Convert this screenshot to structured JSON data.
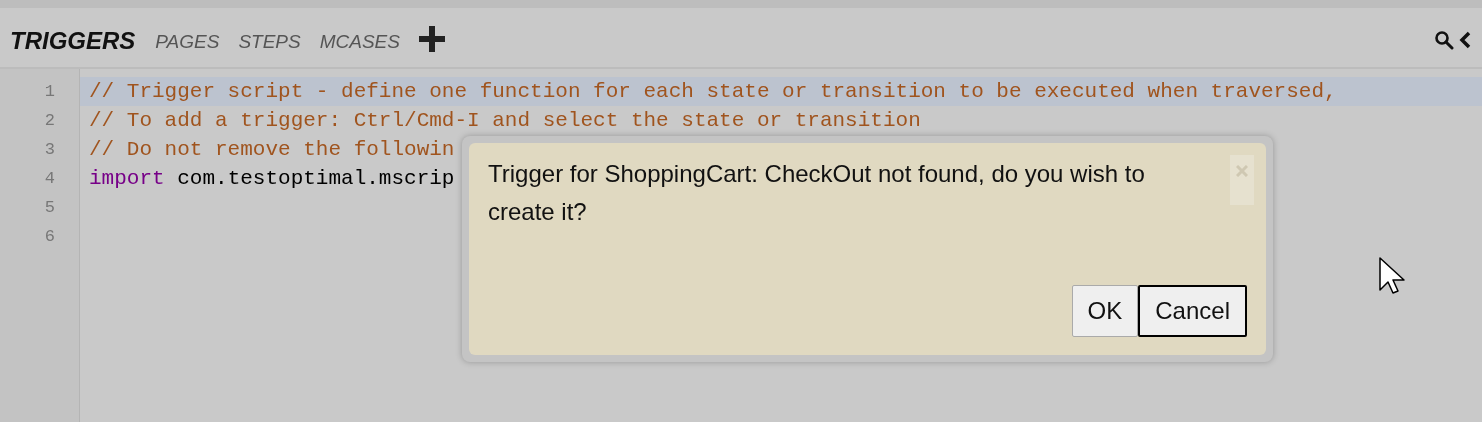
{
  "tabs": [
    {
      "label": "TRIGGERS",
      "selected": true
    },
    {
      "label": "PAGES",
      "selected": false
    },
    {
      "label": "STEPS",
      "selected": false
    },
    {
      "label": "MCASES",
      "selected": false
    }
  ],
  "editor": {
    "lines": [
      {
        "number": "1",
        "highlighted": true,
        "tokens": [
          {
            "kind": "comment",
            "text": "// Trigger script - define one function for each state or transition to be executed when traversed,"
          }
        ]
      },
      {
        "number": "2",
        "highlighted": false,
        "tokens": [
          {
            "kind": "comment",
            "text": "// To add a trigger: Ctrl/Cmd-I and select the state or transition"
          }
        ]
      },
      {
        "number": "3",
        "highlighted": false,
        "tokens": [
          {
            "kind": "comment",
            "text": "// Do not remove the followin"
          }
        ]
      },
      {
        "number": "4",
        "highlighted": false,
        "tokens": [
          {
            "kind": "keyword",
            "text": "import"
          },
          {
            "kind": "plain",
            "text": " com.testoptimal.mscrip"
          }
        ]
      },
      {
        "number": "5",
        "highlighted": false
      },
      {
        "number": "6",
        "highlighted": false
      }
    ]
  },
  "dialog": {
    "message": "Trigger for ShoppingCart: CheckOut not found, do you wish to create it?",
    "buttons": [
      {
        "label": "OK",
        "focused": false
      },
      {
        "label": "Cancel",
        "focused": true
      }
    ]
  }
}
